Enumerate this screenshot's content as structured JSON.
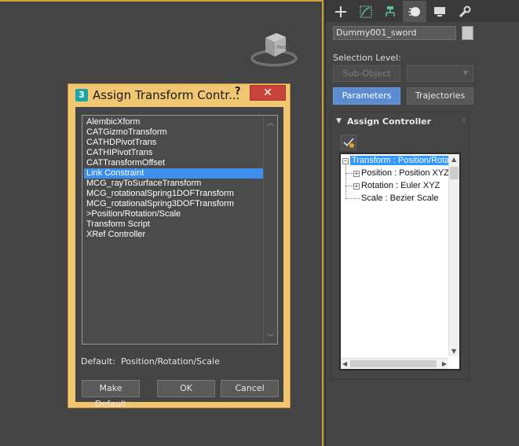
{
  "command_panel": {
    "tabs": [
      {
        "name": "create",
        "icon": "plus-icon"
      },
      {
        "name": "modify",
        "icon": "modify-curve-icon"
      },
      {
        "name": "hierarchy",
        "icon": "hierarchy-icon"
      },
      {
        "name": "motion",
        "icon": "motion-icon",
        "active": true
      },
      {
        "name": "display",
        "icon": "display-monitor-icon"
      },
      {
        "name": "utilities",
        "icon": "wrench-icon"
      }
    ],
    "object_name": "Dummy001_sword",
    "object_color": "#c9c9c9",
    "selection_level_label": "Selection Level:",
    "subobject_label": "Sub-Object",
    "parameters_label": "Parameters",
    "trajectories_label": "Trajectories",
    "rollout": {
      "title": "Assign Controller",
      "tree": [
        {
          "label": "Transform : Position/Rotat",
          "level": 0,
          "expander": "−",
          "selected": true
        },
        {
          "label": "Position : Position XYZ",
          "level": 1,
          "expander": "+"
        },
        {
          "label": "Rotation : Euler XYZ",
          "level": 1,
          "expander": "+"
        },
        {
          "label": "Scale : Bezier Scale",
          "level": 1,
          "expander": ""
        }
      ]
    }
  },
  "dialog": {
    "title": "Assign Transform Contr...",
    "help": "?",
    "close": "✕",
    "icon_label": "3",
    "controllers": [
      "AlembicXform",
      "CATGizmoTransform",
      "CATHDPivotTrans",
      "CATHIPivotTrans",
      "CATTransformOffset",
      "Link Constraint",
      "MCG_rayToSurfaceTransform",
      "MCG_rotationalSpring1DOFTransform",
      "MCG_rotationalSpring3DOFTransform",
      ">Position/Rotation/Scale",
      "Transform Script",
      "XRef Controller"
    ],
    "selected_index": 5,
    "default_label": "Default:",
    "default_value": "Position/Rotation/Scale",
    "buttons": {
      "make_default": "Make Default",
      "ok": "OK",
      "cancel": "Cancel"
    }
  },
  "colors": {
    "viewport_border": "#cfa23a",
    "accent_blue": "#5b8bd0",
    "list_selection": "#3d8fee",
    "dialog_frame": "#f0c670",
    "close_red": "#c8443a"
  }
}
